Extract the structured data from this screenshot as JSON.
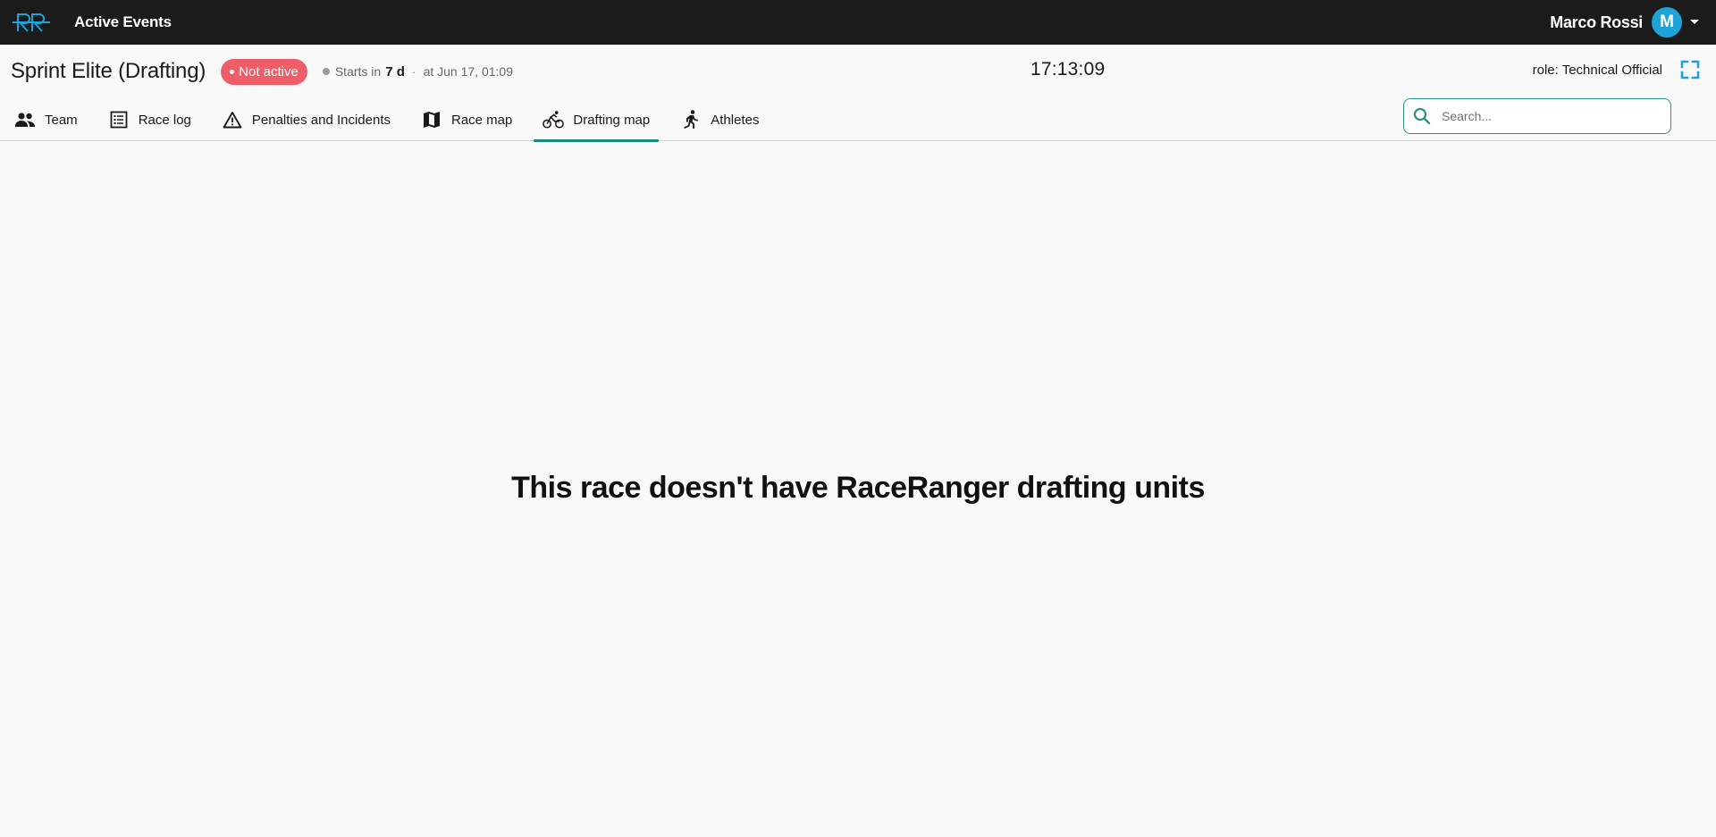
{
  "topbar": {
    "logo_text": "RR",
    "title": "Active Events",
    "user_name": "Marco Rossi",
    "avatar_initial": "M"
  },
  "event": {
    "title": "Sprint Elite (Drafting)",
    "status": "Not active",
    "starts_prefix": "Starts in",
    "starts_value": "7 d",
    "separator": "·",
    "starts_at": "at Jun 17, 01:09",
    "clock": "17:13:09",
    "role": "role: Technical Official"
  },
  "tabs": [
    {
      "label": "Team",
      "icon": "people-icon",
      "active": false
    },
    {
      "label": "Race log",
      "icon": "list-icon",
      "active": false
    },
    {
      "label": "Penalties and Incidents",
      "icon": "warning-icon",
      "active": false
    },
    {
      "label": "Race map",
      "icon": "map-icon",
      "active": false
    },
    {
      "label": "Drafting map",
      "icon": "bike-icon",
      "active": true
    },
    {
      "label": "Athletes",
      "icon": "runner-icon",
      "active": false
    }
  ],
  "search": {
    "placeholder": "Search...",
    "value": ""
  },
  "main": {
    "message": "This race doesn't have RaceRanger drafting units"
  },
  "colors": {
    "topbar": "#1b1b1b",
    "accent": "#1c8a7c",
    "logo": "#1ea2d8",
    "status": "#ee5d68"
  }
}
